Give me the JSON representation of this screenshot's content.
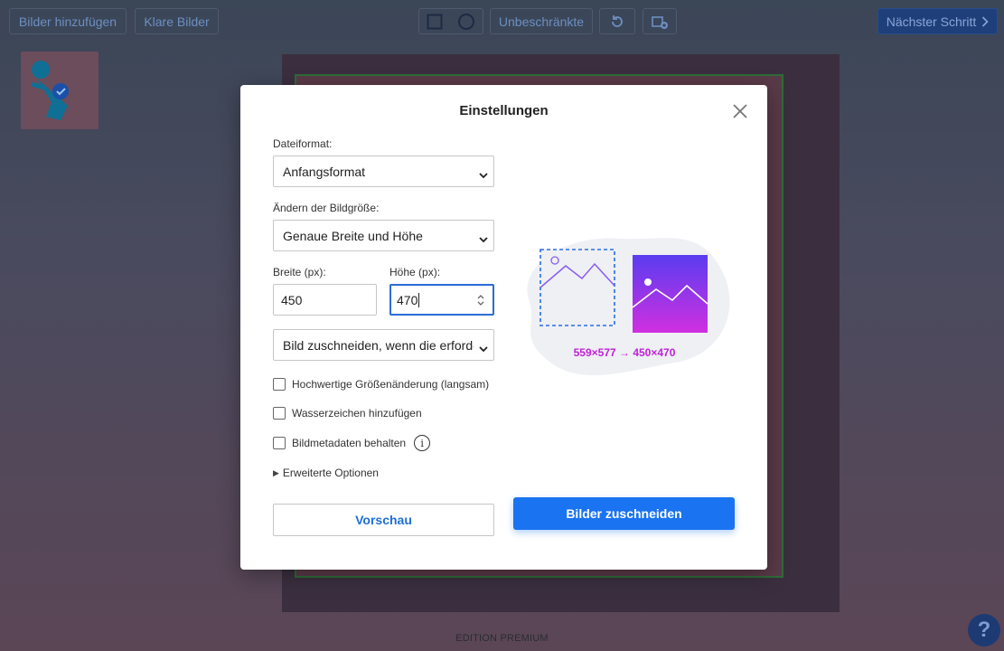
{
  "toolbar": {
    "add_images": "Bilder hinzufügen",
    "clear_images": "Klare Bilder",
    "unrestricted": "Unbeschränkte",
    "next_step": "Nächster Schritt"
  },
  "dialog": {
    "title": "Einstellungen",
    "file_format_label": "Dateiformat:",
    "file_format_value": "Anfangsformat",
    "resize_label": "Ändern der Bildgröße:",
    "resize_value": "Genaue Breite und Höhe",
    "width_label": "Breite (px):",
    "width_value": "450",
    "height_label": "Höhe (px):",
    "height_value": "470",
    "crop_mode_value": "Bild zuschneiden, wenn die erforder",
    "options": [
      {
        "label": "Hochwertige Größenänderung (langsam)",
        "checked": false
      },
      {
        "label": "Wasserzeichen hinzufügen",
        "checked": false
      },
      {
        "label": "Bildmetadaten behalten",
        "checked": false
      }
    ],
    "advanced_label": "Erweiterte Optionen",
    "size_change": "559×577 → 450×470",
    "preview_button": "Vorschau",
    "crop_button": "Bilder zuschneiden"
  },
  "footer": {
    "edition": "EDITION PREMIUM"
  },
  "help": {
    "label": "?"
  },
  "colors": {
    "accent": "#1a73f0",
    "dims_text": "#c020d8",
    "gradient_start": "#8a3cf0",
    "gradient_end": "#d030e0"
  },
  "icons": {
    "square_shape": "square-icon",
    "circle_shape": "circle-icon",
    "rotate": "rotate-icon",
    "add_image": "add-image-icon",
    "close": "close-icon",
    "info": "info-icon",
    "chevron_right": "chevron-right-icon",
    "help": "help-icon"
  }
}
